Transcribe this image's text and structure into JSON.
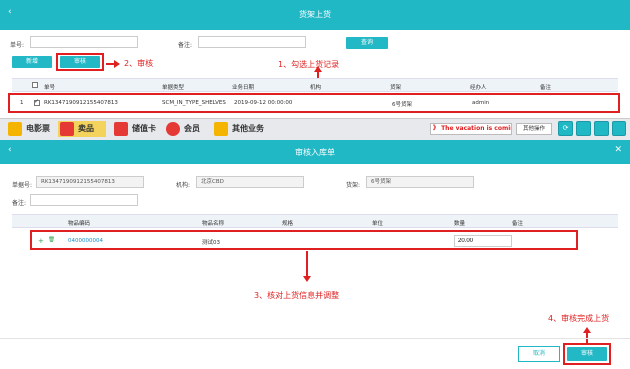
{
  "header": {
    "title": "货架上货",
    "back_icon": "‹"
  },
  "filters": {
    "order_label": "单号:",
    "order_value": "",
    "remark_label": "备注:",
    "remark_value": "",
    "search_label": "查询"
  },
  "toolbar": {
    "add_label": "新增",
    "audit_label": "审核"
  },
  "table": {
    "columns": [
      "单号",
      "单据类型",
      "业务日期",
      "机构",
      "货架",
      "经办人",
      "备注"
    ],
    "rows": [
      {
        "index": "1",
        "order": "RK1347190912155407813",
        "type": "SCM_IN_TYPE_SHELVES",
        "date": "2019-09-12 00:00:00",
        "org": "",
        "shelf": "6号货架",
        "operator": "admin",
        "remark": ""
      }
    ]
  },
  "annotations": {
    "step1": "1、勾选上货记录",
    "step2": "2、审核",
    "step3": "3、核对上货信息并调整",
    "step4": "4、审核完成上货"
  },
  "nav_tabs": [
    {
      "label": "电影票",
      "color": "#f4b400"
    },
    {
      "label": "卖品",
      "color": "#e53935"
    },
    {
      "label": "储值卡",
      "color": "#e53935"
    },
    {
      "label": "会员",
      "color": "#e53935"
    },
    {
      "label": "其他业务",
      "color": "#f4b400"
    }
  ],
  "marquee_text": "》 The vacation is coming",
  "ops_label": "其他操作",
  "modal": {
    "title": "审核入库单",
    "back_icon": "‹",
    "close_icon": "✕",
    "order_label": "单据号:",
    "order_value": "RK1347190912155407813",
    "org_label": "机构:",
    "org_value": "北京CBD",
    "shelf_label": "货架:",
    "shelf_value": "6号货架",
    "remark_label": "备注:",
    "remark_value": "",
    "columns": [
      "物品编码",
      "物品名称",
      "规格",
      "单位",
      "数量",
      "备注"
    ],
    "rows": [
      {
        "code": "0400000004",
        "name": "测试03",
        "spec": "",
        "unit": "",
        "qty": "20.00",
        "remark": ""
      }
    ],
    "cancel_label": "取消",
    "audit_label": "审核"
  },
  "colors": {
    "accent": "#21b8c6",
    "annotation": "#e02020"
  }
}
